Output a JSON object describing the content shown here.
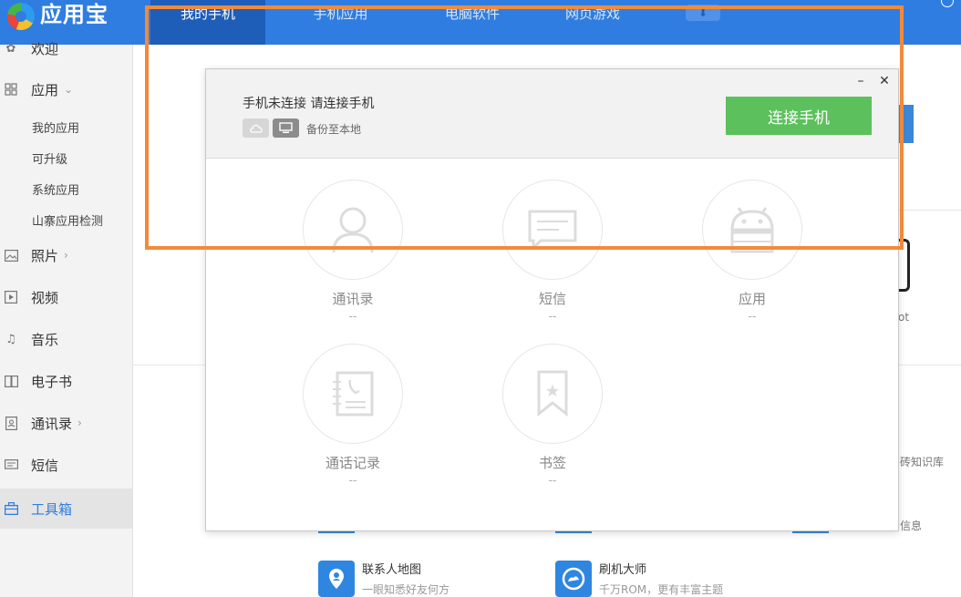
{
  "app": {
    "name": "应用宝"
  },
  "header": {
    "tabs": [
      {
        "label": "我的手机",
        "active": true
      },
      {
        "label": "手机应用"
      },
      {
        "label": "电脑软件"
      },
      {
        "label": "网页游戏"
      }
    ]
  },
  "sidebar": {
    "items": [
      {
        "label": "欢迎",
        "icon": "settings-icon"
      },
      {
        "label": "应用",
        "icon": "grid-icon"
      },
      {
        "label": "照片",
        "icon": "image-icon"
      },
      {
        "label": "视频",
        "icon": "video-icon"
      },
      {
        "label": "音乐",
        "icon": "music-icon"
      },
      {
        "label": "电子书",
        "icon": "book-icon"
      },
      {
        "label": "通讯录",
        "icon": "contacts-icon"
      },
      {
        "label": "短信",
        "icon": "message-icon"
      },
      {
        "label": "工具箱",
        "icon": "toolbox-icon",
        "active": true
      }
    ],
    "subitems": [
      "我的应用",
      "可升级",
      "系统应用",
      "山寨应用检测"
    ]
  },
  "dialog": {
    "title": "手机未连接 请连接手机",
    "backup_label": "备份至本地",
    "connect_button": "连接手机",
    "minimize": "–",
    "close": "✕",
    "features": [
      {
        "label": "通讯录",
        "value": "--",
        "icon": "person-icon"
      },
      {
        "label": "短信",
        "value": "--",
        "icon": "message-icon"
      },
      {
        "label": "应用",
        "value": "--",
        "icon": "android-icon"
      },
      {
        "label": "通话记录",
        "value": "--",
        "icon": "call-log-icon"
      },
      {
        "label": "书签",
        "value": "--",
        "icon": "bookmark-icon"
      }
    ]
  },
  "background": {
    "right_text_1": "ot",
    "right_text_2": "砖知识库",
    "right_text_3": "信息",
    "tools": [
      {
        "title": "联系人地图",
        "desc": "一眼知悉好友何方",
        "icon": "location-icon"
      },
      {
        "title": "刷机大师",
        "desc": "千万ROM，更有丰富主题",
        "icon": "flash-icon"
      }
    ]
  },
  "colors": {
    "header_blue": "#2f7de1",
    "active_tab": "#1e5db8",
    "connect_green": "#5cc05c",
    "highlight_orange": "#f28a3a"
  }
}
